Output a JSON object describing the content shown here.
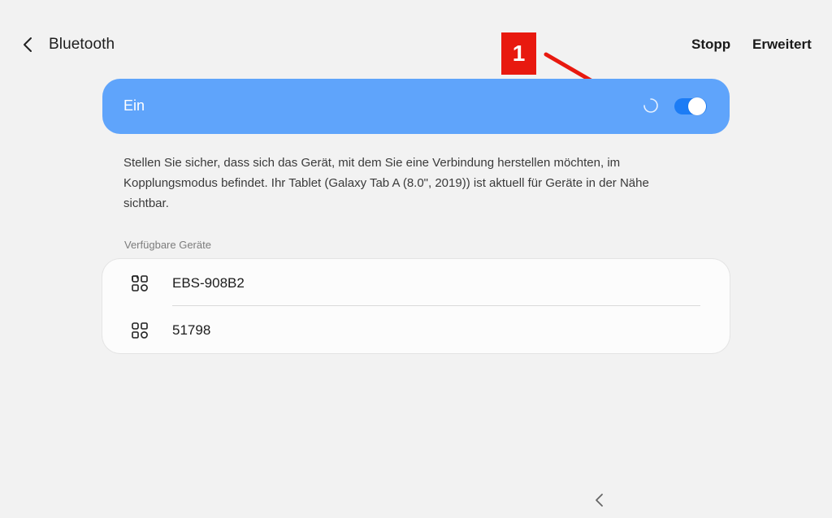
{
  "header": {
    "title": "Bluetooth",
    "back_icon": "chevron-left-icon",
    "actions": {
      "stop_label": "Stopp",
      "advanced_label": "Erweitert"
    }
  },
  "annotation": {
    "marker_number": "1",
    "color": "#e8190f"
  },
  "bluetooth_switch": {
    "label": "Ein",
    "state": true,
    "scanning": true,
    "card_color": "#5fa4fb",
    "toggle_color": "#1c7cf5"
  },
  "description": "Stellen Sie sicher, dass sich das Gerät, mit dem Sie eine Verbindung herstellen möchten, im Kopplungsmodus befindet. Ihr Tablet (Galaxy Tab A (8.0\", 2019)) ist aktuell für Geräte in der Nähe sichtbar.",
  "available_devices": {
    "header": "Verfügbare Geräte",
    "devices": [
      {
        "name": "EBS-908B2",
        "icon": "device-generic-icon"
      },
      {
        "name": "51798",
        "icon": "device-generic-icon"
      }
    ]
  },
  "navigation": {
    "back_icon": "nav-back-icon"
  }
}
